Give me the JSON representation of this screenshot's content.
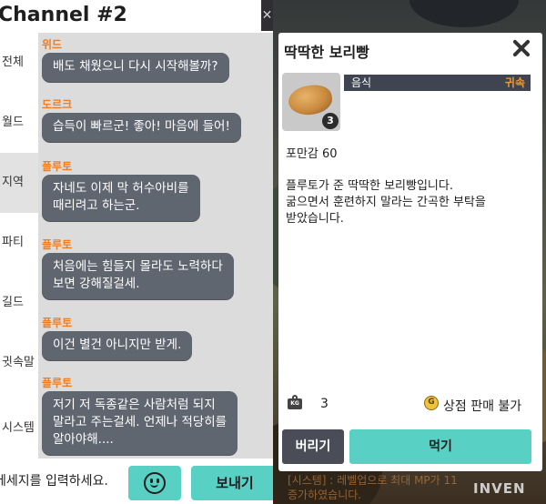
{
  "chat": {
    "title": "Channel #2",
    "close_glyph": "✕",
    "sidebar": [
      "전체",
      "월드",
      "지역",
      "파티",
      "길드",
      "귓속말",
      "시스템"
    ],
    "active_tab": "지역",
    "messages": [
      {
        "speaker": "위드",
        "text": "배도 채웠으니 다시 시작해볼까?"
      },
      {
        "speaker": "도르크",
        "text": "습득이 빠르군! 좋아! 마음에 들어!"
      },
      {
        "speaker": "플루토",
        "text": "자네도 이제 막 허수아비를\n때리려고 하는군."
      },
      {
        "speaker": "플루토",
        "text": "처음에는 힘들지 몰라도 노력하다\n보면 강해질걸세."
      },
      {
        "speaker": "플루토",
        "text": "이건 별건 아니지만 받게."
      },
      {
        "speaker": "플루토",
        "text": "저기 저 독종같은 사람처럼 되지\n말라고 주는걸세. 언제나 적당히를\n알아야해...."
      }
    ],
    "input_placeholder": "메세지를 입력하세요.",
    "emoji_icon": "smile-icon",
    "send_label": "보내기"
  },
  "item_popup": {
    "title": "딱딱한 보리빵",
    "close_icon": "close-icon",
    "item_icon": "bread-icon",
    "count": "3",
    "category": "음식",
    "binding": "귀속",
    "satiety": "포만감 60",
    "description": "플루토가 준 딱딱한 보리빵입니다.\n굶으면서 훈련하지 말라는 간곡한 부탁을\n받았습니다.",
    "weight_icon_text": "KG",
    "weight_value": "3",
    "coin_glyph": "G",
    "shop_label": "상점 판매 불가",
    "drop_label": "버리기",
    "eat_label": "먹기"
  },
  "game_log": "[시스템] : 레벨업으로 최대 MP가 11\n증가하였습니다.",
  "watermark": "INVEN",
  "colors": {
    "accent": "#58d0c4",
    "speaker": "#f07d20",
    "bubble": "#5f6670",
    "binding": "#f29a2e",
    "category_bar": "#3f4450",
    "drop_button": "#4a4d57"
  }
}
